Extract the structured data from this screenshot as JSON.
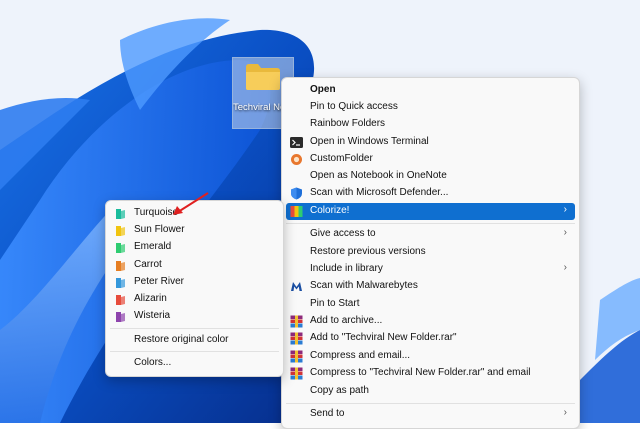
{
  "desktop": {
    "folder_label": "Techviral New Folder"
  },
  "context_menu": {
    "items": [
      {
        "label": "Open",
        "icon": "none"
      },
      {
        "label": "Pin to Quick access",
        "icon": "none"
      },
      {
        "label": "Rainbow Folders",
        "icon": "none"
      },
      {
        "label": "Open in Windows Terminal",
        "icon": "terminal-icon"
      },
      {
        "label": "CustomFolder",
        "icon": "customfolder-icon"
      },
      {
        "label": "Open as Notebook in OneNote",
        "icon": "none"
      },
      {
        "label": "Scan with Microsoft Defender...",
        "icon": "defender-shield-icon"
      },
      {
        "label": "Colorize!",
        "icon": "colorize-icon"
      },
      {
        "label": "Give access to",
        "icon": "none"
      },
      {
        "label": "Restore previous versions",
        "icon": "none"
      },
      {
        "label": "Include in library",
        "icon": "none"
      },
      {
        "label": "Scan with Malwarebytes",
        "icon": "malwarebytes-icon"
      },
      {
        "label": "Pin to Start",
        "icon": "none"
      },
      {
        "label": "Add to archive...",
        "icon": "winrar-icon"
      },
      {
        "label": "Add to \"Techviral New Folder.rar\"",
        "icon": "winrar-icon"
      },
      {
        "label": "Compress and email...",
        "icon": "winrar-icon"
      },
      {
        "label": "Compress to \"Techviral New Folder.rar\" and email",
        "icon": "winrar-icon"
      },
      {
        "label": "Copy as path",
        "icon": "none"
      },
      {
        "label": "Send to",
        "icon": "none"
      }
    ]
  },
  "colorize_submenu": {
    "colors": [
      {
        "label": "Turquoise",
        "color": "#1abc9c"
      },
      {
        "label": "Sun Flower",
        "color": "#f1c40f"
      },
      {
        "label": "Emerald",
        "color": "#2ecc71"
      },
      {
        "label": "Carrot",
        "color": "#e67e22"
      },
      {
        "label": "Peter River",
        "color": "#3498db"
      },
      {
        "label": "Alizarin",
        "color": "#e74c3c"
      },
      {
        "label": "Wisteria",
        "color": "#8e44ad"
      }
    ],
    "restore_label": "Restore original color",
    "colors_label": "Colors..."
  },
  "theme": {
    "selected_bg": "#0f6fd0",
    "annotation_color": "#e02020"
  }
}
